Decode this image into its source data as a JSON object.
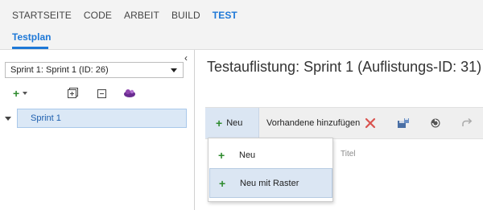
{
  "nav": {
    "tabs": [
      {
        "label": "STARTSEITE"
      },
      {
        "label": "CODE"
      },
      {
        "label": "ARBEIT"
      },
      {
        "label": "BUILD"
      },
      {
        "label": "TEST"
      }
    ],
    "active_tab": "TEST",
    "subtab": "Testplan"
  },
  "left_panel": {
    "collapse_icon": "chevron-left-icon",
    "sprint_select": {
      "value": "Sprint 1: Sprint 1 (ID: 26)"
    },
    "toolbar_icons": [
      "add-icon",
      "expand-all-icon",
      "collapse-all-icon",
      "suite-options-icon"
    ],
    "tree": [
      {
        "label": "Sprint 1",
        "expanded": true,
        "selected": true
      }
    ]
  },
  "content": {
    "title": "Testauflistung: Sprint 1 (Auflistungs-ID: 31)",
    "toolbar": {
      "new_label": "Neu",
      "existing_label": "Vorhandene hinzufügen",
      "icons": [
        "delete-icon",
        "save-icon",
        "refresh-icon",
        "redo-icon"
      ]
    },
    "column_header": "Titel",
    "dropdown": {
      "items": [
        {
          "label": "Neu"
        },
        {
          "label": "Neu mit Raster",
          "highlighted": true
        }
      ]
    }
  },
  "colors": {
    "accent": "#1e78d7",
    "green_plus": "#2e8b2e",
    "delete_red": "#d9534f",
    "selection_bg": "#dbe8f6"
  }
}
